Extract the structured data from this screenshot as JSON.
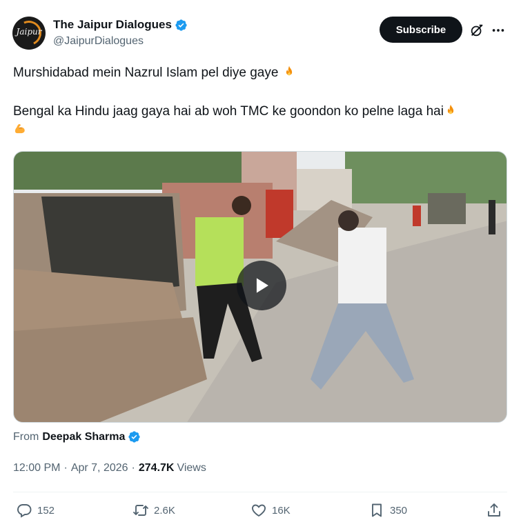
{
  "header": {
    "display_name": "The Jaipur Dialogues",
    "handle": "@JaipurDialogues",
    "avatar_text": "Jaipur",
    "subscribe_label": "Subscribe"
  },
  "tweet": {
    "line1": "Murshidabad mein Nazrul Islam pel diye gaye",
    "line2": "Bengal ka Hindu jaag gaya hai ab woh TMC ke goondon ko pelne laga hai"
  },
  "from": {
    "label": "From",
    "name": "Deepak Sharma"
  },
  "meta": {
    "time": "12:00 PM",
    "date": "Apr 7, 2026",
    "views_count": "274.7K",
    "views_label": "Views"
  },
  "actions": {
    "replies": "152",
    "reposts": "2.6K",
    "likes": "16K",
    "bookmarks": "350"
  },
  "colors": {
    "text_primary": "#0f1419",
    "text_secondary": "#536471",
    "verified_blue": "#1d9bf0",
    "subscribe_bg": "#0f1419"
  },
  "icons": [
    "verified-badge-icon",
    "grok-icon",
    "more-icon",
    "fire-emoji-icon",
    "flexed-biceps-emoji-icon",
    "play-icon",
    "reply-icon",
    "repost-icon",
    "like-icon",
    "bookmark-icon",
    "share-icon"
  ]
}
